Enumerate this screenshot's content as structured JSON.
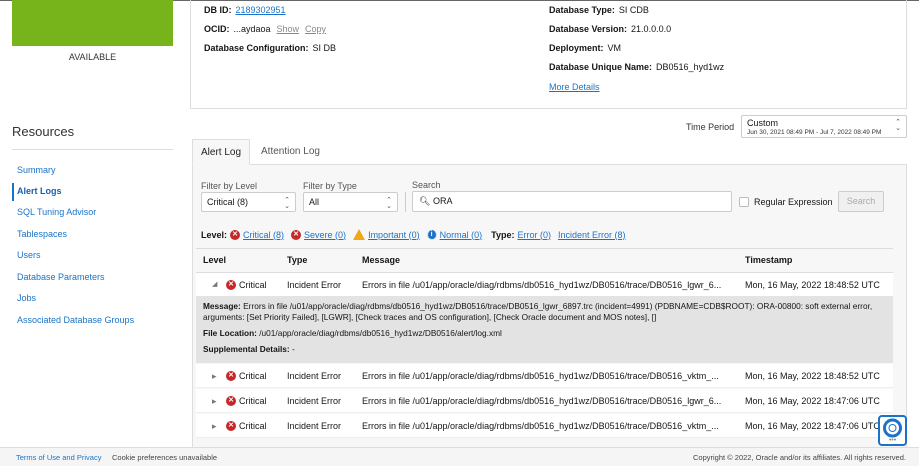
{
  "status": "AVAILABLE",
  "info": {
    "db_id_label": "DB ID:",
    "db_id": "2189302951",
    "ocid_label": "OCID:",
    "ocid": "...aydaoa",
    "show": "Show",
    "copy": "Copy",
    "config_label": "Database Configuration:",
    "config": "SI DB",
    "type_label": "Database Type:",
    "type": "SI CDB",
    "version_label": "Database Version:",
    "version": "21.0.0.0.0",
    "deployment_label": "Deployment:",
    "deployment": "VM",
    "unique_label": "Database Unique Name:",
    "unique": "DB0516_hyd1wz",
    "more": "More Details"
  },
  "sidebar": {
    "title": "Resources",
    "items": [
      "Summary",
      "Alert Logs",
      "SQL Tuning Advisor",
      "Tablespaces",
      "Users",
      "Database Parameters",
      "Jobs",
      "Associated Database Groups"
    ],
    "active": "Alert Logs"
  },
  "time_period": {
    "label": "Time Period",
    "value": "Custom",
    "range": "Jun 30, 2021 08:49 PM - Jul 7, 2022 08:49 PM"
  },
  "tabs": [
    "Alert Log",
    "Attention Log"
  ],
  "filters": {
    "level_label": "Filter by Level",
    "level": "Critical (8)",
    "type_label": "Filter by Type",
    "type": "All",
    "search_label": "Search",
    "search": "ORA",
    "regex": "Regular Expression",
    "search_button": "Search"
  },
  "summary": {
    "level_label": "Level:",
    "critical": "Critical (8)",
    "severe": "Severe (0)",
    "important": "Important (0)",
    "normal": "Normal (0)",
    "type_label": "Type:",
    "error": "Error (0)",
    "incident": "Incident Error (8)"
  },
  "table": {
    "headers": [
      "Level",
      "Type",
      "Message",
      "Timestamp"
    ],
    "rows": [
      {
        "level": "Critical",
        "type": "Incident Error",
        "message": "Errors in file /u01/app/oracle/diag/rdbms/db0516_hyd1wz/DB0516/trace/DB0516_lgwr_6...",
        "timestamp": "Mon, 16 May, 2022 18:48:52 UTC"
      },
      {
        "level": "Critical",
        "type": "Incident Error",
        "message": "Errors in file /u01/app/oracle/diag/rdbms/db0516_hyd1wz/DB0516/trace/DB0516_vktm_...",
        "timestamp": "Mon, 16 May, 2022 18:48:52 UTC"
      },
      {
        "level": "Critical",
        "type": "Incident Error",
        "message": "Errors in file /u01/app/oracle/diag/rdbms/db0516_hyd1wz/DB0516/trace/DB0516_lgwr_6...",
        "timestamp": "Mon, 16 May, 2022 18:47:06 UTC"
      },
      {
        "level": "Critical",
        "type": "Incident Error",
        "message": "Errors in file /u01/app/oracle/diag/rdbms/db0516_hyd1wz/DB0516/trace/DB0516_vktm_...",
        "timestamp": "Mon, 16 May, 2022 18:47:06 UTC"
      }
    ],
    "detail": {
      "message_label": "Message:",
      "message": "Errors in file /u01/app/oracle/diag/rdbms/db0516_hyd1wz/DB0516/trace/DB0516_lgwr_6897.trc (incident=4991) (PDBNAME=CDB$ROOT): ORA-00800: soft external error, arguments: [Set Priority Failed], [LGWR], [Check traces and OS configuration], [Check Oracle document and MOS notes], []",
      "file_label": "File Location:",
      "file": "/u01/app/oracle/diag/rdbms/db0516_hyd1wz/DB0516/alert/log.xml",
      "supp_label": "Supplemental Details:",
      "supp": "-"
    }
  },
  "footer": {
    "terms": "Terms of Use and Privacy",
    "cookies": "Cookie preferences unavailable",
    "copyright": "Copyright © 2022, Oracle and/or its affiliates. All rights reserved."
  }
}
